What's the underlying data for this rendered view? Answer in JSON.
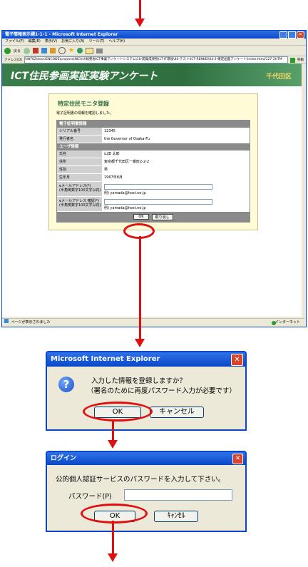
{
  "browser": {
    "title": "電子情報表示標1-1-1 - Microsoft Internet Explorer",
    "menu": [
      "ファイル(F)",
      "編集(E)",
      "表示(V)",
      "お気に入り(A)",
      "ツール(T)",
      "ヘルプ(H)"
    ],
    "toolbar_label": "戻る",
    "address_label": "アドレス(D)",
    "address_value": "\\\\WF02\\docs\\ENCODE\\projects\\NICHU\\総務省ICT事業アンケートシステム\\10-開発成果物\\1T-IT環境\\40-テスト\\ICT-RENKEI\\04-2-確定画面アンケート\\index.html/127-2HTM",
    "go_label": "移動",
    "status_left": "ページが表示されました",
    "status_right": "インターネット"
  },
  "page": {
    "banner_title": "ICT住民参画実証実験アンケート",
    "banner_city": "千代田区",
    "form_title": "特定住民モニタ登録",
    "form_note": "電子証明書の情報を確認しました。",
    "cert_section": "電子証明書情報",
    "user_section": "ユーザ情報",
    "rows_cert": [
      {
        "label": "シリアル番号",
        "value": "12345"
      },
      {
        "label": "発行者名",
        "value": "the Governor of Osaka-Fu"
      }
    ],
    "rows_user": [
      {
        "label": "氏名",
        "value": "山田 太郎"
      },
      {
        "label": "住所",
        "value": "東京都千代田区一番町2-2-2"
      },
      {
        "label": "性別",
        "value": "男"
      },
      {
        "label": "生年月",
        "value": "1967年8月"
      }
    ],
    "email_label": "eメールアドレス(*)",
    "email_note": "(半角英数字100文字以内)",
    "email_example": "例) yamada@host.ne.jp",
    "email_confirm_label": "eメールアドレス 確認(*)",
    "email_confirm_note": "(半角英数字100文字以内)",
    "email_confirm_example": "例) yamada@host.ne.jp",
    "ok_label": "OK",
    "cancel_label": "取り消し"
  },
  "dialog1": {
    "title": "Microsoft Internet Explorer",
    "line1": "入力した情報を登録しますか？",
    "line2": "（署名のために再度パスワード入力が必要です）",
    "ok": "OK",
    "cancel": "キャンセル"
  },
  "dialog2": {
    "title": "ログイン",
    "message": "公的個人認証サービスのパスワードを入力して下さい。",
    "password_label": "パスワード(P)",
    "password_value": "",
    "ok": "OK",
    "cancel": "ｷｬﾝｾﾙ"
  },
  "colors": {
    "accent_red": "#e01010",
    "xp_blue": "#0a47c8",
    "banner_green": "#2f6f3f"
  }
}
